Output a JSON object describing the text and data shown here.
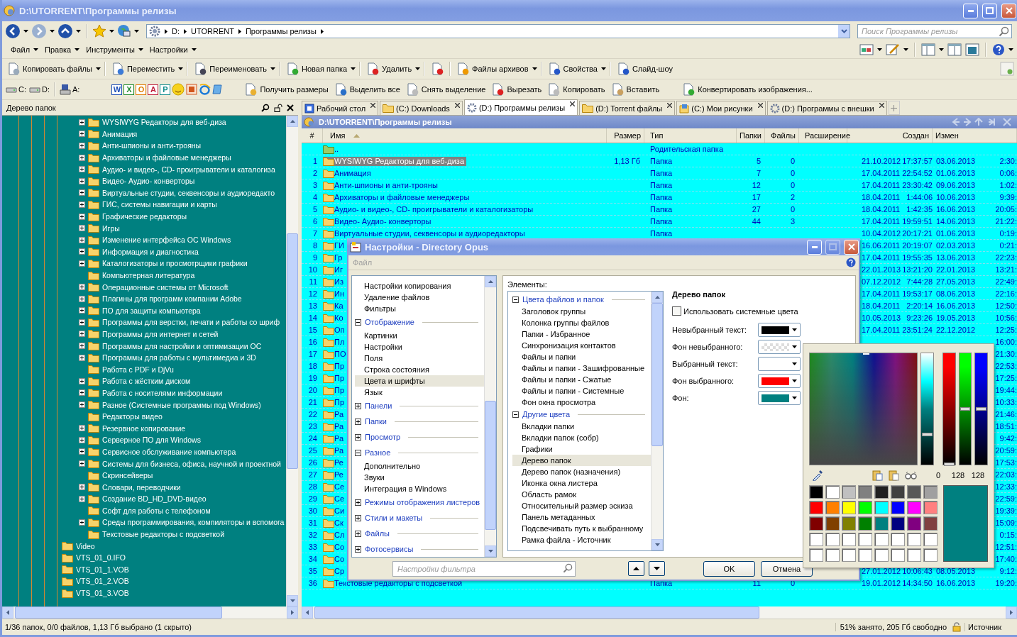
{
  "window": {
    "title": "D:\\UTORRENT\\Программы релизы"
  },
  "address_bar": {
    "crumbs": [
      "D:",
      "UTORRENT",
      "Программы релизы"
    ]
  },
  "search": {
    "placeholder": "Поиск Программы релизы"
  },
  "menu": [
    "Файл",
    "Правка",
    "Инструменты",
    "Настройки"
  ],
  "toolbar": [
    {
      "label": "Копировать файлы",
      "dropdown": true
    },
    {
      "label": "Переместить",
      "dropdown": true
    },
    {
      "label": "Переименовать",
      "dropdown": true
    },
    {
      "label": "Новая папка",
      "dropdown": true
    },
    {
      "label": "Удалить",
      "dropdown": true
    },
    {
      "dropdown": false
    },
    {
      "label": "Файлы архивов",
      "dropdown": true
    },
    {
      "label": "Свойства",
      "dropdown": true
    },
    {
      "label": "Слайд-шоу",
      "dropdown": false
    }
  ],
  "toolbar2": {
    "drives": [
      "C:",
      "D:",
      "A:"
    ],
    "launchers": [
      {
        "glyph": "W",
        "color": "#1d4fb8"
      },
      {
        "glyph": "X",
        "color": "#1f8a2e"
      },
      {
        "glyph": "O",
        "color": "#e07b00"
      },
      {
        "glyph": "A",
        "color": "#c0203c"
      },
      {
        "glyph": "P",
        "color": "#168f8f"
      }
    ],
    "actions": [
      "Получить размеры",
      "Выделить все",
      "Снять выделение",
      "Вырезать",
      "Копировать",
      "Вставить",
      "Конвертировать изображения..."
    ]
  },
  "folder_tree": {
    "title": "Дерево папок",
    "items": [
      {
        "children": [
          {
            "label": "WYSIWYG Редакторы для веб-диза",
            "expandable": true
          },
          {
            "label": "Анимация",
            "expandable": true
          },
          {
            "label": "Анти-шпионы и анти-трояны",
            "expandable": true
          },
          {
            "label": "Архиваторы и файловые менеджеры",
            "expandable": true
          },
          {
            "label": "Аудио- и видео-, CD- проигрыватели и каталогиза",
            "expandable": true
          },
          {
            "label": "Видео- Аудио- конверторы",
            "expandable": true
          },
          {
            "label": "Виртуальные студии, секвенсоры и аудиоредакто",
            "expandable": true
          },
          {
            "label": "ГИС, системы навигации и карты",
            "expandable": true
          },
          {
            "label": "Графические редакторы",
            "expandable": true
          },
          {
            "label": "Игры",
            "expandable": true
          },
          {
            "label": "Изменение интерфейса ОС Windows",
            "expandable": true
          },
          {
            "label": "Информация и диагностика",
            "expandable": true
          },
          {
            "label": "Каталогизаторы и просмотрщики графики",
            "expandable": true
          },
          {
            "label": "Компьютерная литература",
            "expandable": false
          },
          {
            "label": "Операционные системы от Microsoft",
            "expandable": true
          },
          {
            "label": "Плагины для программ компании Adobe",
            "expandable": true
          },
          {
            "label": "ПО для защиты компьютера",
            "expandable": true
          },
          {
            "label": "Программы для верстки, печати и работы со шриф",
            "expandable": true
          },
          {
            "label": "Программы для интернет и сетей",
            "expandable": true
          },
          {
            "label": "Программы для настройки и оптимизации ОС",
            "expandable": true
          },
          {
            "label": "Программы для работы с мультимедиа и 3D",
            "expandable": true
          },
          {
            "label": "Работа с PDF и DjVu",
            "expandable": false
          },
          {
            "label": "Работа с жёстким диском",
            "expandable": true
          },
          {
            "label": "Работа с носителями информации",
            "expandable": true
          },
          {
            "label": "Разное (Системные программы под Windows)",
            "expandable": true
          },
          {
            "label": "Редакторы видео",
            "expandable": false
          },
          {
            "label": "Резервное копирование",
            "expandable": true
          },
          {
            "label": "Серверное ПО для Windows",
            "expandable": true
          },
          {
            "label": "Сервисное обслуживание компьютера",
            "expandable": true
          },
          {
            "label": "Системы для бизнеса, офиса, научной и проектной",
            "expandable": true
          },
          {
            "label": "Скринсейверы",
            "expandable": false
          },
          {
            "label": "Словари, переводчики",
            "expandable": true
          },
          {
            "label": "Создание BD_HD_DVD-видео",
            "expandable": true
          },
          {
            "label": "Софт для работы с телефоном",
            "expandable": false
          },
          {
            "label": "Среды программирования, компиляторы и вспомога",
            "expandable": true
          },
          {
            "label": "Текстовые редакторы с подсветкой",
            "expandable": false
          }
        ]
      },
      {
        "label": "Video",
        "expandable": false
      },
      {
        "label": "VTS_01_0.IFO",
        "expandable": false
      },
      {
        "label": "VTS_01_1.VOB",
        "expandable": false
      },
      {
        "label": "VTS_01_2.VOB",
        "expandable": false
      },
      {
        "label": "VTS_01_3.VOB",
        "expandable": false
      }
    ]
  },
  "tabs": [
    {
      "label": "Рабочий стол",
      "selected": false
    },
    {
      "label": "(C:) Downloads",
      "selected": false
    },
    {
      "label": "(D:) Программы релизы",
      "selected": true
    },
    {
      "label": "(D:) Torrent файлы",
      "selected": false
    },
    {
      "label": "(C:) Мои рисунки",
      "selected": false
    },
    {
      "label": "(D:) Программы с внешки",
      "selected": false
    }
  ],
  "lister": {
    "path": "D:\\UTORRENT\\Программы релизы",
    "columns": [
      {
        "label": "#",
        "sorted": false
      },
      {
        "label": "Имя",
        "sorted": true
      },
      {
        "label": "Размер",
        "sorted": false
      },
      {
        "label": "Тип",
        "sorted": false
      },
      {
        "label": "Папки",
        "sorted": false
      },
      {
        "label": "Файлы",
        "sorted": false
      },
      {
        "label": "Расширение",
        "sorted": false
      },
      {
        "label": "Создан",
        "sorted": false
      },
      {
        "label": "Измен",
        "sorted": false
      }
    ],
    "parent": {
      "name": "..",
      "type": "Родительская папка"
    },
    "rows": [
      {
        "n": "1",
        "name": "WYSIWYG Редакторы для веб-диза",
        "size": "1,13 Гб",
        "type": "Папка",
        "folders": "5",
        "files": "0",
        "cdate": "21.10.2012",
        "ctime": "17:37:57",
        "mdate": "03.06.2013",
        "mtime": "2:30:",
        "selected": true
      },
      {
        "n": "2",
        "name": "Анимация",
        "type": "Папка",
        "folders": "7",
        "files": "0",
        "cdate": "17.04.2011",
        "ctime": "22:54:52",
        "mdate": "01.06.2013",
        "mtime": "0:06:",
        "selected": false
      },
      {
        "n": "3",
        "name": "Анти-шпионы и анти-трояны",
        "type": "Папка",
        "folders": "12",
        "files": "0",
        "cdate": "17.04.2011",
        "ctime": "23:30:42",
        "mdate": "09.06.2013",
        "mtime": "1:02:",
        "selected": false
      },
      {
        "n": "4",
        "name": "Архиваторы и файловые менеджеры",
        "type": "Папка",
        "folders": "17",
        "files": "2",
        "cdate": "18.04.2011",
        "ctime": "1:44:06",
        "mdate": "10.06.2013",
        "mtime": "9:39:",
        "selected": false
      },
      {
        "n": "5",
        "name": "Аудио- и видео-, CD- проигрыватели и каталогизаторы",
        "type": "Папка",
        "folders": "27",
        "files": "0",
        "cdate": "18.04.2011",
        "ctime": "1:42:35",
        "mdate": "16.06.2013",
        "mtime": "20:05:",
        "selected": false
      },
      {
        "n": "6",
        "name": "Видео- Аудио- конверторы",
        "type": "Папка",
        "folders": "44",
        "files": "3",
        "cdate": "17.04.2011",
        "ctime": "19:59:51",
        "mdate": "14.06.2013",
        "mtime": "21:22:",
        "selected": false
      },
      {
        "n": "7",
        "name": "Виртуальные студии, секвенсоры и аудиоредакторы",
        "type": "Папка",
        "cdate": "10.04.2012",
        "ctime": "20:17:21",
        "mdate": "01.06.2013",
        "mtime": "0:19:",
        "selected": false
      },
      {
        "n": "8",
        "name": "ГИ",
        "cdate": "16.06.2011",
        "ctime": "20:19:07",
        "mdate": "02.03.2013",
        "mtime": "0:21:",
        "selected": false
      },
      {
        "n": "9",
        "name": "Гр",
        "cdate": "17.04.2011",
        "ctime": "19:55:35",
        "mdate": "13.06.2013",
        "mtime": "22:23:",
        "selected": false
      },
      {
        "n": "10",
        "name": "Иг",
        "cdate": "22.01.2013",
        "ctime": "13:21:20",
        "mdate": "22.01.2013",
        "mtime": "13:21:",
        "selected": false
      },
      {
        "n": "11",
        "name": "Из",
        "cdate": "07.12.2012",
        "ctime": "7:44:28",
        "mdate": "27.05.2013",
        "mtime": "22:49:",
        "selected": false
      },
      {
        "n": "12",
        "name": "Ин",
        "cdate": "17.04.2011",
        "ctime": "19:53:17",
        "mdate": "08.06.2013",
        "mtime": "22:16:",
        "selected": false
      },
      {
        "n": "13",
        "name": "Ка",
        "cdate": "18.04.2011",
        "ctime": "2:20:14",
        "mdate": "16.06.2013",
        "mtime": "12:50:",
        "selected": false
      },
      {
        "n": "14",
        "name": "Ко",
        "cdate": "10.05.2013",
        "ctime": "9:23:26",
        "mdate": "19.05.2013",
        "mtime": "10:56:",
        "selected": false
      },
      {
        "n": "15",
        "name": "Оп",
        "cdate": "17.04.2011",
        "ctime": "23:51:24",
        "mdate": "22.12.2012",
        "mtime": "12:25:",
        "selected": false
      },
      {
        "n": "16",
        "name": "Пл",
        "mtime": "16:00:",
        "selected": false
      },
      {
        "n": "17",
        "name": "ПО",
        "mtime": "21:30:",
        "selected": false
      },
      {
        "n": "18",
        "name": "Пр",
        "mtime": "22:53:",
        "selected": false
      },
      {
        "n": "19",
        "name": "Пр",
        "mtime": "17:25:",
        "selected": false
      },
      {
        "n": "20",
        "name": "Пр",
        "mtime": "19:44:",
        "selected": false
      },
      {
        "n": "21",
        "name": "Пр",
        "mtime": "10:33:",
        "selected": false
      },
      {
        "n": "22",
        "name": "Ра",
        "mtime": "21:46:",
        "selected": false
      },
      {
        "n": "23",
        "name": "Ра",
        "mtime": "18:51:",
        "selected": false
      },
      {
        "n": "24",
        "name": "Ра",
        "mtime": "9:42:",
        "selected": false
      },
      {
        "n": "25",
        "name": "Ра",
        "mtime": "20:59:",
        "selected": false
      },
      {
        "n": "26",
        "name": "Ре",
        "mtime": "17:53:",
        "selected": false
      },
      {
        "n": "27",
        "name": "Ре",
        "mtime": "22:03:",
        "selected": false
      },
      {
        "n": "28",
        "name": "Се",
        "mtime": "12:33:",
        "selected": false
      },
      {
        "n": "29",
        "name": "Се",
        "mtime": "22:59:",
        "selected": false
      },
      {
        "n": "30",
        "name": "Си",
        "mtime": "19:39:",
        "selected": false
      },
      {
        "n": "31",
        "name": "Ск",
        "mtime": "15:09:",
        "selected": false
      },
      {
        "n": "32",
        "name": "Сл",
        "mtime": "0:15:",
        "selected": false
      },
      {
        "n": "33",
        "name": "Со",
        "mtime": "12:51:",
        "selected": false
      },
      {
        "n": "34",
        "name": "Со",
        "mtime": "17:40:",
        "selected": false
      },
      {
        "n": "35",
        "name": "Ср",
        "cdate": "27.01.2012",
        "ctime": "10:06:43",
        "mdate": "08.05.2013",
        "mtime": "9:12:",
        "selected": false
      },
      {
        "n": "36",
        "name": "Текстовые редакторы с подсветкой",
        "type": "Папка",
        "folders": "11",
        "files": "0",
        "cdate": "19.01.2012",
        "ctime": "14:34:50",
        "mdate": "16.06.2013",
        "mtime": "19:20:",
        "selected": false
      }
    ]
  },
  "status_bar": {
    "selection": "1/36 папок, 0/0 файлов, 1,13 Гб выбрано (1 скрыто)",
    "disk": "51% занято, 205 Гб свободно",
    "side": "Источник"
  },
  "dialog": {
    "title": "Настройки - Directory Opus",
    "menu": "Файл",
    "settings_tree": [
      {
        "children": [
          {
            "label": "Настройки копирования",
            "selected": false
          },
          {
            "label": "Удаление файлов",
            "selected": false
          },
          {
            "label": "Фильтры",
            "selected": false
          }
        ]
      },
      {
        "label": "Отображение",
        "expanded": true,
        "selected": false,
        "children": [
          {
            "label": "Картинки",
            "selected": false
          },
          {
            "label": "Настройки",
            "selected": false
          },
          {
            "label": "Поля",
            "selected": false
          },
          {
            "label": "Строка состояния",
            "selected": false
          },
          {
            "label": "Цвета и шрифты",
            "selected": true
          },
          {
            "label": "Язык",
            "selected": false
          }
        ]
      },
      {
        "label": "Панели",
        "expanded": false,
        "selected": false
      },
      {
        "label": "Папки",
        "expanded": false,
        "selected": false
      },
      {
        "label": "Просмотр",
        "expanded": false,
        "selected": false
      },
      {
        "label": "Разное",
        "expanded": true,
        "selected": false,
        "children": [
          {
            "label": "Дополнительно",
            "selected": false
          },
          {
            "label": "Звуки",
            "selected": false
          },
          {
            "label": "Интеграция в Windows",
            "selected": false
          }
        ]
      },
      {
        "label": "Режимы отображения листеров",
        "expanded": false,
        "selected": false
      },
      {
        "label": "Стили и макеты",
        "expanded": false,
        "selected": false
      },
      {
        "label": "Файлы",
        "expanded": false,
        "selected": false
      },
      {
        "label": "Фотосервисы",
        "expanded": false,
        "selected": false
      }
    ],
    "elements_label": "Элементы:",
    "elements": [
      {
        "label": "Цвета файлов и папок",
        "expanded": true,
        "children": [
          {
            "label": "Заголовок группы",
            "selected": false
          },
          {
            "label": "Колонка группы файлов",
            "selected": false
          },
          {
            "label": "Папки - Избранное",
            "selected": false
          },
          {
            "label": "Синхронизация контактов",
            "selected": false
          },
          {
            "label": "Файлы и папки",
            "selected": false
          },
          {
            "label": "Файлы и папки - Зашифрованные",
            "selected": false
          },
          {
            "label": "Файлы и папки - Сжатые",
            "selected": false
          },
          {
            "label": "Файлы и папки - Системные",
            "selected": false
          },
          {
            "label": "Фон окна просмотра",
            "selected": false
          }
        ]
      },
      {
        "label": "Другие цвета",
        "expanded": true,
        "children": [
          {
            "label": "Вкладки папки",
            "selected": false
          },
          {
            "label": "Вкладки папок (собр)",
            "selected": false
          },
          {
            "label": "Графики",
            "selected": false
          },
          {
            "label": "Дерево папок",
            "selected": true
          },
          {
            "label": "Дерево папок (назначения)",
            "selected": false
          },
          {
            "label": "Иконка окна листера",
            "selected": false
          },
          {
            "label": "Область рамок",
            "selected": false
          },
          {
            "label": "Относительный размер эскиза",
            "selected": false
          },
          {
            "label": "Панель метаданных",
            "selected": false
          },
          {
            "label": "Подсвечивать путь к выбранному",
            "selected": false
          },
          {
            "label": "Рамка файла - Источник",
            "selected": false
          }
        ]
      }
    ],
    "panel_title": "Дерево папок",
    "use_system_colors": {
      "label": "Использовать системные цвета",
      "checked": false
    },
    "swatches": [
      {
        "label": "Невыбранный текст:",
        "kind": "solid",
        "color": "#000000"
      },
      {
        "label": "Фон невыбранного:",
        "kind": "transparent"
      },
      {
        "label": "Выбранный текст:",
        "kind": "solid",
        "color": "#ffffff"
      },
      {
        "label": "Фон выбранного:",
        "kind": "solid",
        "color": "#ff0000"
      },
      {
        "label": "Фон:",
        "kind": "solid",
        "color": "#008080"
      }
    ],
    "filter": {
      "placeholder": "Настройки фильтра"
    },
    "buttons": [
      "OK",
      "Отмена"
    ]
  },
  "color_picker": {
    "brightness": {
      "level": 0.27
    },
    "channels": [
      {
        "color": "#ff0000",
        "level": 0,
        "reading": "0"
      },
      {
        "color": "#00ff00",
        "level": 0.5,
        "reading": "128"
      },
      {
        "color": "#0000ff",
        "level": 0.5,
        "reading": "128"
      }
    ],
    "palette": [
      {
        "color": "#000000"
      },
      {
        "color": "#ffffff"
      },
      {
        "color": "#c0c0c0"
      },
      {
        "color": "#808080"
      },
      {
        "color": "#202020"
      },
      {
        "color": "#404040"
      },
      {
        "color": "#585858"
      },
      {
        "color": "#a0a0a0"
      },
      {
        "color": "#ff0000"
      },
      {
        "color": "#ff8000"
      },
      {
        "color": "#ffff00"
      },
      {
        "color": "#00ff00"
      },
      {
        "color": "#00ffff"
      },
      {
        "color": "#0000ff"
      },
      {
        "color": "#ff00ff"
      },
      {
        "color": "#ff8080"
      },
      {
        "color": "#800000"
      },
      {
        "color": "#804000"
      },
      {
        "color": "#808000"
      },
      {
        "color": "#008000"
      },
      {
        "color": "#008080"
      },
      {
        "color": "#000080"
      },
      {
        "color": "#800080"
      },
      {
        "color": "#804040"
      },
      {
        "color": "#ffffff"
      },
      {
        "color": "#ffffff"
      },
      {
        "color": "#ffffff"
      },
      {
        "color": "#ffffff"
      },
      {
        "color": "#ffffff"
      },
      {
        "color": "#ffffff"
      },
      {
        "color": "#ffffff"
      },
      {
        "color": "#ffffff"
      },
      {
        "color": "#ffffff"
      },
      {
        "color": "#ffffff"
      },
      {
        "color": "#ffffff"
      },
      {
        "color": "#ffffff"
      },
      {
        "color": "#ffffff"
      },
      {
        "color": "#ffffff"
      },
      {
        "color": "#ffffff"
      },
      {
        "color": "#ffffff"
      }
    ],
    "preview": {
      "color": "#008080"
    }
  }
}
